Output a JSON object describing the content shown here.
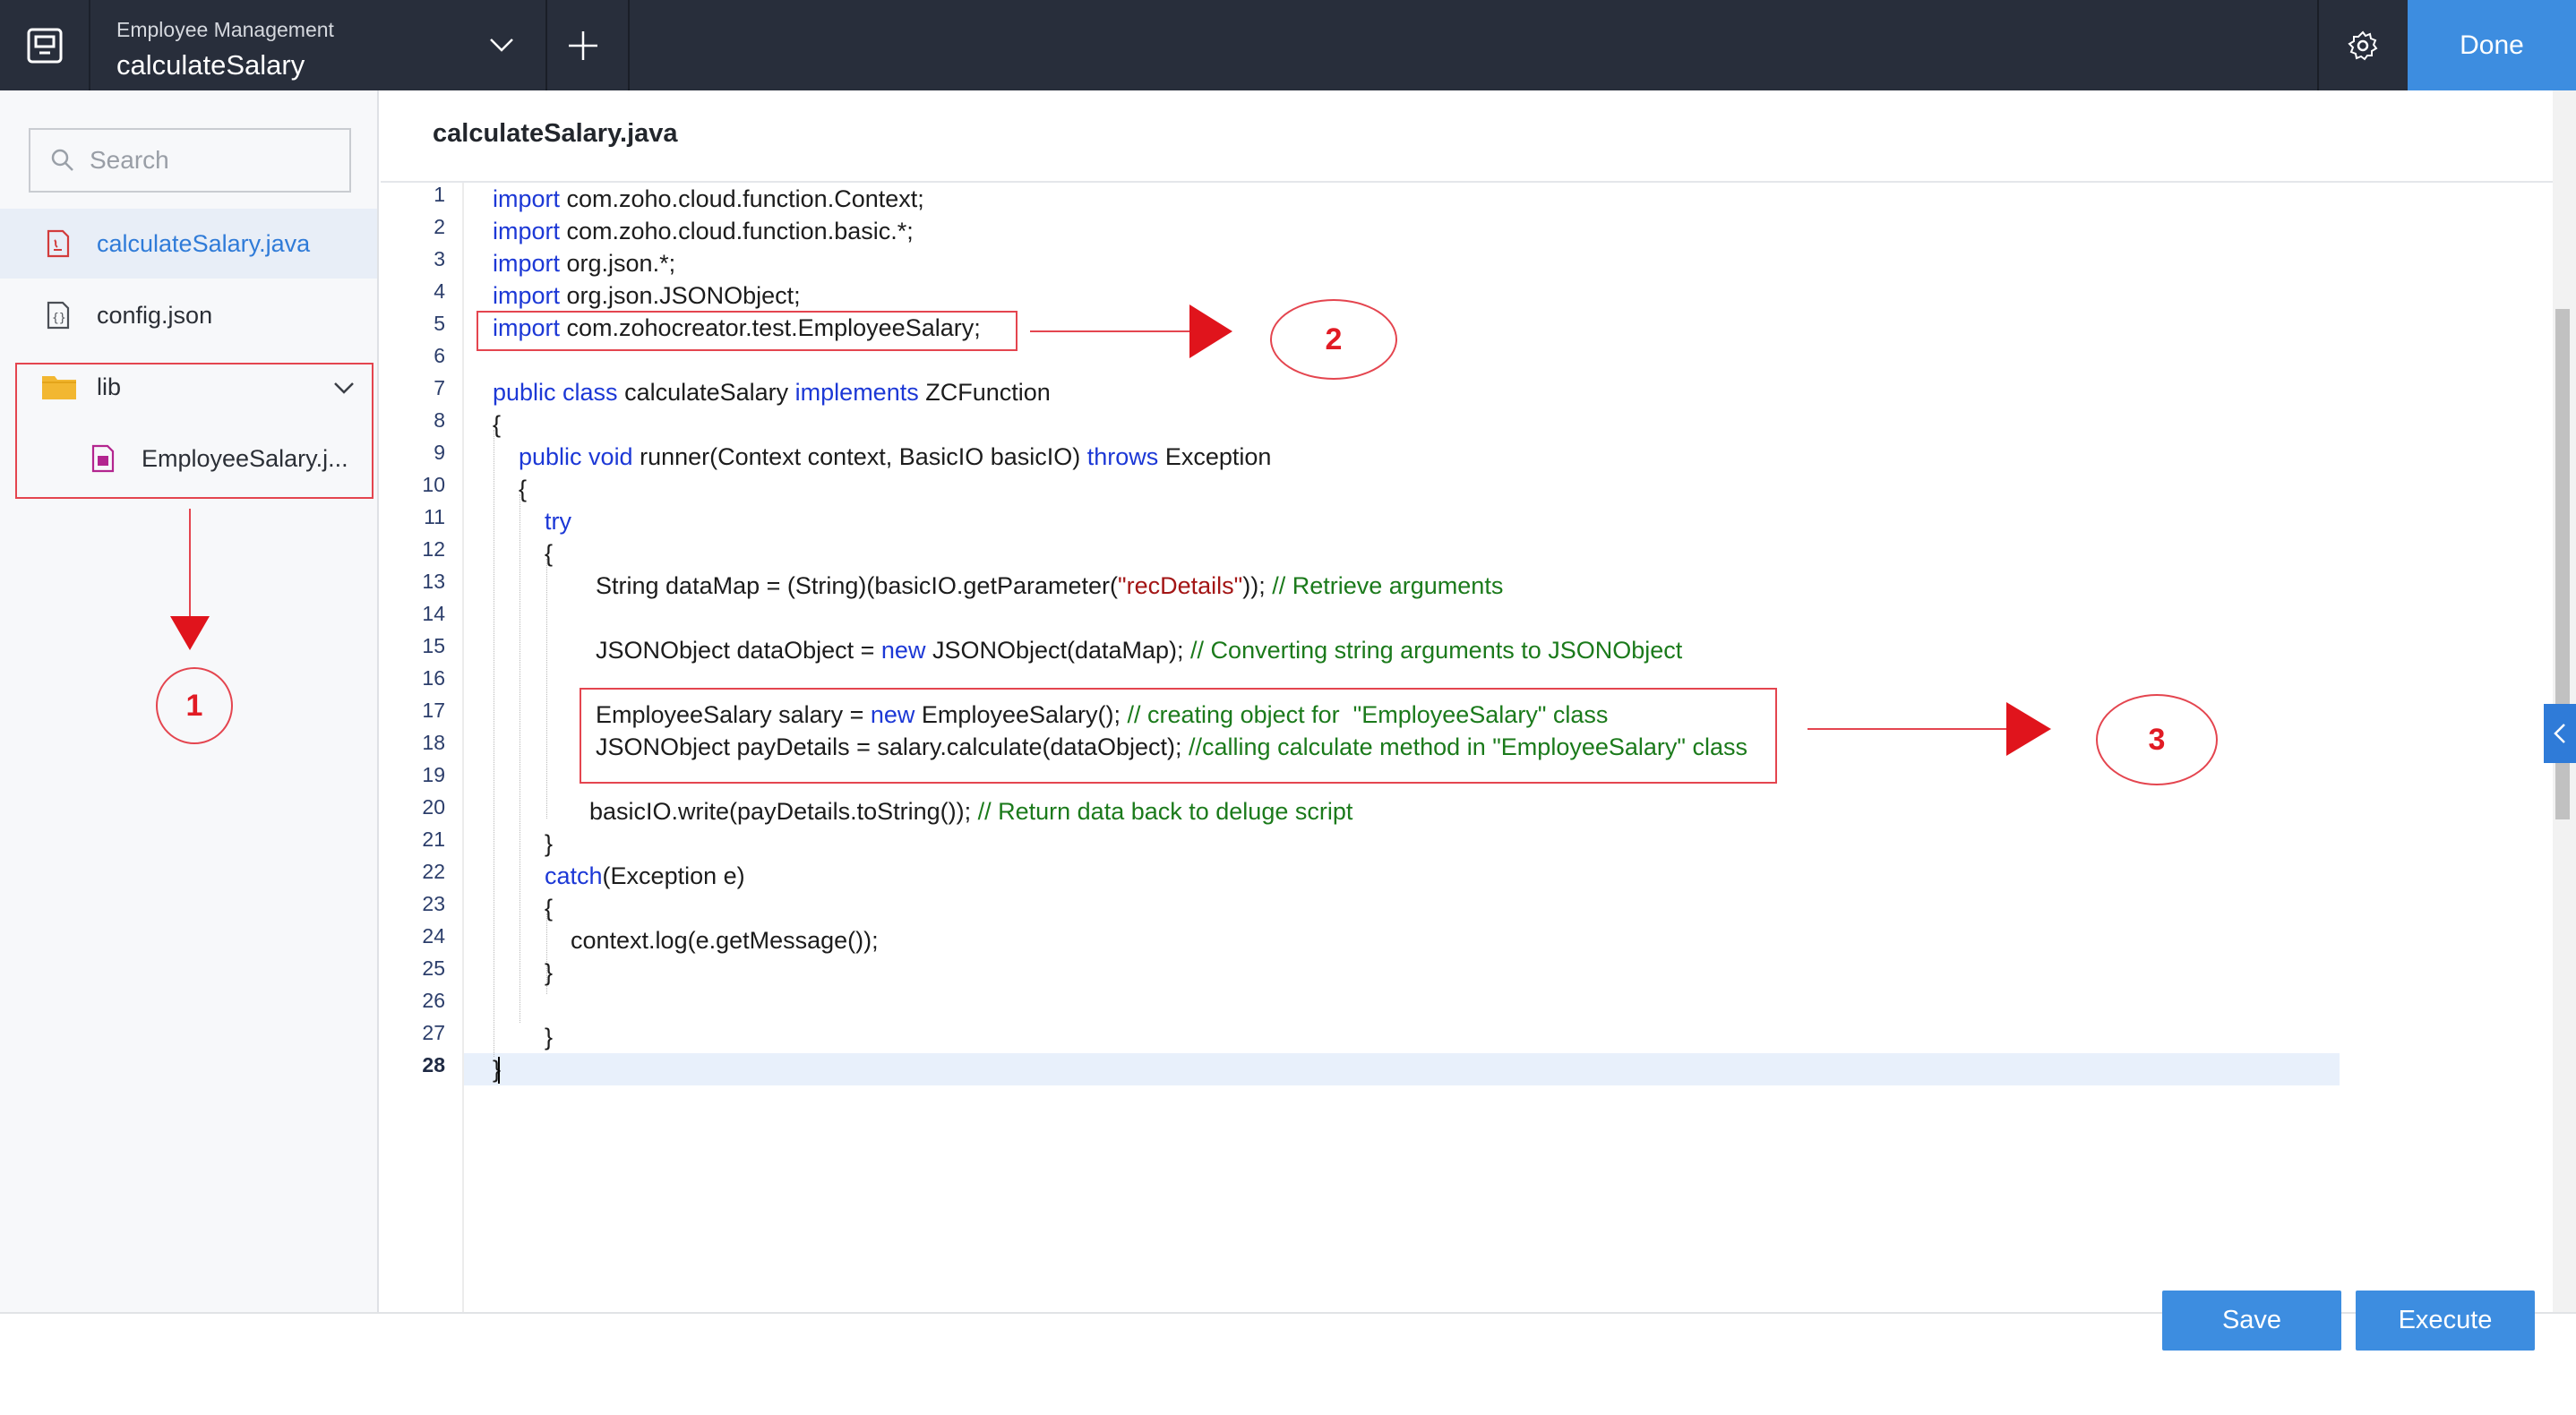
{
  "header": {
    "project_name": "Employee Management",
    "function_name": "calculateSalary",
    "done_label": "Done"
  },
  "sidebar": {
    "search_placeholder": "Search",
    "files": [
      {
        "name": "calculateSalary.java",
        "active": true
      },
      {
        "name": "config.json",
        "active": false
      }
    ],
    "folder": {
      "name": "lib",
      "children": [
        "EmployeeSalary.j..."
      ]
    }
  },
  "editor": {
    "tab_title": "calculateSalary.java",
    "line_numbers": [
      "1",
      "2",
      "3",
      "4",
      "5",
      "6",
      "7",
      "8",
      "9",
      "10",
      "11",
      "12",
      "13",
      "14",
      "15",
      "16",
      "17",
      "18",
      "19",
      "20",
      "21",
      "22",
      "23",
      "24",
      "25",
      "26",
      "27",
      "28"
    ],
    "current_line": "28",
    "code": {
      "l1": {
        "kw": "import",
        "rest": " com.zoho.cloud.function.Context;"
      },
      "l2": {
        "kw": "import",
        "rest": " com.zoho.cloud.function.basic.*;"
      },
      "l3": {
        "kw": "import",
        "rest": " org.json.*;"
      },
      "l4": {
        "kw": "import",
        "rest": " org.json.JSONObject;"
      },
      "l5": {
        "kw": "import",
        "rest": " com.zohocreator.test.EmployeeSalary;"
      },
      "l7": {
        "kw1": "public class",
        "mid": " calculateSalary ",
        "kw2": "implements",
        "rest": " ZCFunction"
      },
      "l8": {
        "text": "{"
      },
      "l9": {
        "kw1": "public void",
        "mid": " runner(Context context, BasicIO basicIO) ",
        "kw2": "throws",
        "rest": " Exception"
      },
      "l10": {
        "text": "{"
      },
      "l11": {
        "kw": "try"
      },
      "l12": {
        "text": "{"
      },
      "l13": {
        "a": "String dataMap = (String)(basicIO.getParameter(",
        "str": "\"recDetails\"",
        "b": ")); ",
        "cm": "// Retrieve arguments"
      },
      "l15": {
        "a": "JSONObject dataObject = ",
        "kw": "new",
        "b": " JSONObject(dataMap); ",
        "cm": "// Converting string arguments to JSONObject"
      },
      "l17": {
        "a": "EmployeeSalary salary = ",
        "kw": "new",
        "b": " EmployeeSalary(); ",
        "cm": "// creating object for  \"EmployeeSalary\" class"
      },
      "l18": {
        "a": "JSONObject payDetails = salary.calculate(dataObject); ",
        "cm": "//calling calculate method in \"EmployeeSalary\" class"
      },
      "l20": {
        "a": "basicIO.write(payDetails.toString()); ",
        "cm": "// Return data back to deluge script"
      },
      "l21": {
        "text": "}"
      },
      "l22": {
        "kw": "catch",
        "rest": "(Exception e)"
      },
      "l23": {
        "text": "{"
      },
      "l24": {
        "text": "context.log(e.getMessage());"
      },
      "l25": {
        "text": "}"
      },
      "l27": {
        "text": "}"
      },
      "l28": {
        "text": "}"
      }
    }
  },
  "annotations": {
    "one": "1",
    "two": "2",
    "three": "3"
  },
  "footer": {
    "save_label": "Save",
    "execute_label": "Execute"
  },
  "colors": {
    "accent": "#3d8de0",
    "topbar": "#282e3b",
    "annotation": "#e11b24",
    "keyword": "#1c38d6",
    "comment": "#1b7a1b",
    "string": "#a31515"
  }
}
